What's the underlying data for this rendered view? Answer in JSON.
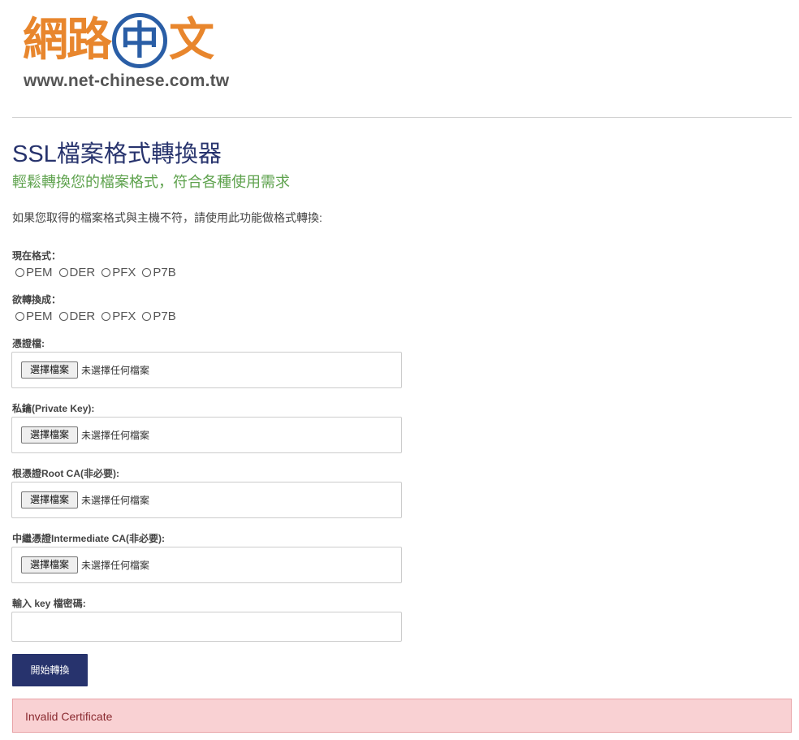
{
  "logo": {
    "chars": [
      "網",
      "路",
      "中",
      "文"
    ],
    "url": "www.net-chinese.com.tw",
    "colors": {
      "orange": "#e8862d",
      "blue": "#2a5ea6"
    }
  },
  "page": {
    "title": "SSL檔案格式轉換器",
    "subtitle": "輕鬆轉換您的檔案格式，符合各種使用需求",
    "intro": "如果您取得的檔案格式與主機不符，請使用此功能做格式轉換:"
  },
  "form": {
    "current_format": {
      "label": "現在格式：",
      "options": [
        "PEM",
        "DER",
        "PFX",
        "P7B"
      ]
    },
    "target_format": {
      "label": "欲轉換成：",
      "options": [
        "PEM",
        "DER",
        "PFX",
        "P7B"
      ]
    },
    "file_fields": [
      {
        "label": "憑證檔:",
        "button": "選擇檔案",
        "status": "未選擇任何檔案"
      },
      {
        "label": "私鑰(Private Key):",
        "button": "選擇檔案",
        "status": "未選擇任何檔案"
      },
      {
        "label": "根憑證Root CA(非必要):",
        "button": "選擇檔案",
        "status": "未選擇任何檔案"
      },
      {
        "label": "中繼憑證Intermediate CA(非必要):",
        "button": "選擇檔案",
        "status": "未選擇任何檔案"
      }
    ],
    "password": {
      "label": "輸入 key 檔密碼:",
      "value": ""
    },
    "submit_label": "開始轉換"
  },
  "alert": {
    "message": "Invalid Certificate"
  },
  "colors": {
    "title": "#27336d",
    "subtitle": "#5ea24d",
    "button": "#27336d",
    "alert_bg": "#f9d1d3",
    "alert_text": "#8a2a30"
  }
}
